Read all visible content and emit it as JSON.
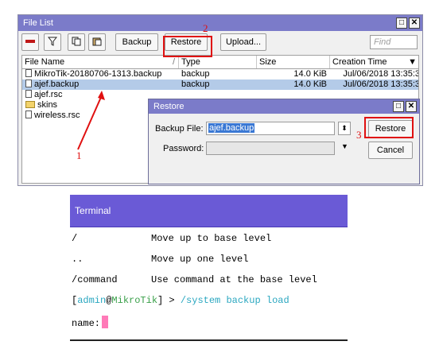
{
  "filelist": {
    "title": "File List",
    "window_buttons": [
      "□",
      "✕"
    ],
    "toolbar": {
      "remove": "—",
      "filter": "▼",
      "copy": "⎘",
      "paste": "📋",
      "backup": "Backup",
      "restore": "Restore",
      "upload": "Upload...",
      "find_placeholder": "Find"
    },
    "columns": [
      "File Name",
      "Type",
      "Size",
      "Creation Time"
    ],
    "sort_marker": "/",
    "rows": [
      {
        "name": "MikroTik-20180706-1313.backup",
        "type": "backup",
        "size": "14.0 KiB",
        "time": "Jul/06/2018 13:35:3",
        "icon": "file-icon"
      },
      {
        "name": "ajef.backup",
        "type": "backup",
        "size": "14.0 KiB",
        "time": "Jul/06/2018 13:35:3",
        "icon": "file-icon",
        "selected": true
      },
      {
        "name": "ajef.rsc",
        "type": "",
        "size": "",
        "time": "",
        "icon": "file-icon"
      },
      {
        "name": "skins",
        "type": "",
        "size": "",
        "time": "",
        "icon": "folder-icon"
      },
      {
        "name": "wireless.rsc",
        "type": "",
        "size": "",
        "time": "",
        "icon": "file-icon"
      }
    ]
  },
  "restore_dialog": {
    "title": "Restore",
    "window_buttons": [
      "□",
      "✕"
    ],
    "backup_file_label": "Backup File:",
    "backup_file_value": "ajef.backup",
    "password_label": "Password:",
    "password_value": "",
    "restore_button": "Restore",
    "cancel_button": "Cancel"
  },
  "annotations": {
    "step1": "1",
    "step2": "2",
    "step3": "3",
    "color": "#e01010"
  },
  "terminal": {
    "title": "Terminal",
    "lines": [
      {
        "cmd": "/",
        "desc": "Move up to base level"
      },
      {
        "cmd": "..",
        "desc": "Move up one level"
      },
      {
        "cmd": "/command",
        "desc": "Use command at the base level"
      }
    ],
    "prompt_user": "admin",
    "prompt_at": "@",
    "prompt_host": "MikroTik",
    "prompt_tail": "] > ",
    "prompt_open": "[",
    "prompt_command": "/system backup load",
    "name_prompt": "name:"
  }
}
